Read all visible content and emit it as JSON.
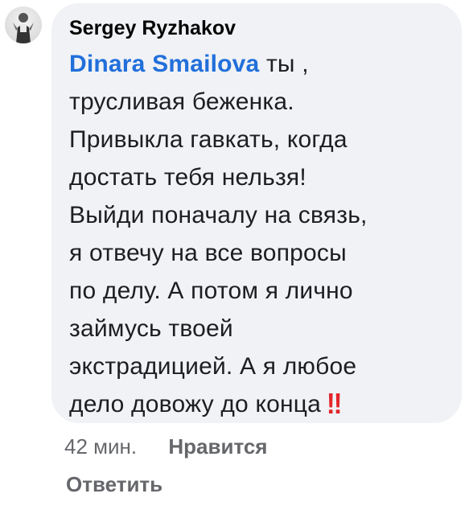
{
  "comment": {
    "author": "Sergey Ryzhakov",
    "mention": "Dinara Smailova",
    "first_line_rest": " ты ,",
    "lines": [
      "трусливая беженка.",
      "Привыкла гавкать, когда",
      "достать тебя нельзя!",
      "Выйди поначалу на связь,",
      "я отвечу на все вопросы",
      "по делу. А потом я лично",
      "займусь твоей",
      "экстрадицией. А я любое"
    ],
    "last_line": "дело довожу до конца",
    "emoji": "‼",
    "emoji_name": "double-exclamation-icon"
  },
  "meta": {
    "timestamp": "42 мин.",
    "like_label": "Нравится",
    "reply_label": "Ответить"
  },
  "colors": {
    "bubble_bg": "#f0f2f5",
    "mention": "#216fdb",
    "meta_text": "#65676b",
    "emoji": "#e3262c"
  }
}
